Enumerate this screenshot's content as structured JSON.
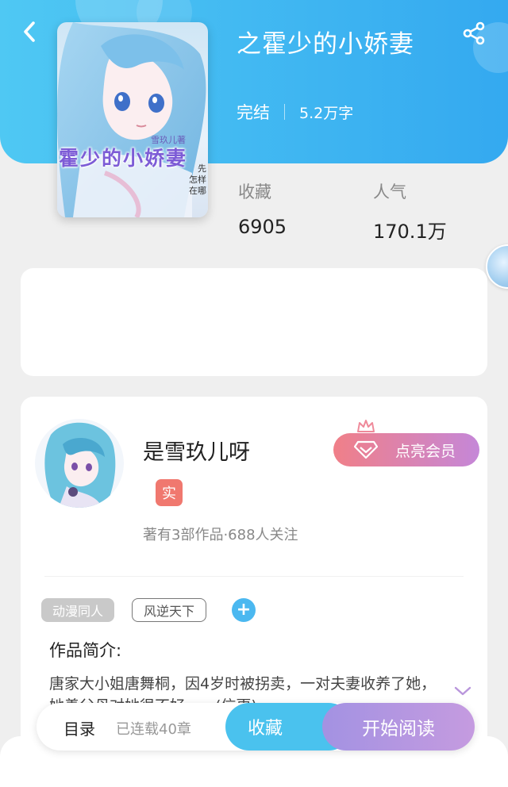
{
  "header": {
    "back_icon": "chevron-left-icon",
    "share_icon": "share-icon"
  },
  "book": {
    "title": "之霍少的小娇妻",
    "status": "完结",
    "word_count": "5.2万字",
    "cover": {
      "title": "霍少的小娇妻",
      "author": "雪玖儿著",
      "side_text": [
        "先",
        "怎样",
        "在哪"
      ]
    }
  },
  "stats": {
    "favorites_label": "收藏",
    "favorites_value": "6905",
    "popularity_label": "人气",
    "popularity_value": "170.1万"
  },
  "author": {
    "name": "是雪玖儿呀",
    "badge": "实",
    "meta": "著有3部作品·688人关注",
    "vip_button": "点亮会员"
  },
  "tags": {
    "genre": "动漫同人",
    "series": "风逆天下",
    "add": "+"
  },
  "intro": {
    "heading": "作品简介:",
    "text": "唐家大小姐唐舞桐，因4岁时被拐卖，一对夫妻收养了她，她善父母对她很不好……(信更)"
  },
  "bottom_bar": {
    "toc_label": "目录",
    "chapters_label": "已连载40章",
    "favorite_button": "收藏",
    "read_button": "开始阅读"
  },
  "colors": {
    "header_gradient_start": "#4fc8f3",
    "header_gradient_end": "#34a9f0",
    "vip_gradient_start": "#f07f88",
    "vip_gradient_end": "#c587d8",
    "favorite_button": "#4ac2ee",
    "read_gradient_start": "#a392e2",
    "read_gradient_end": "#c59be0",
    "badge_red": "#f0786f"
  }
}
